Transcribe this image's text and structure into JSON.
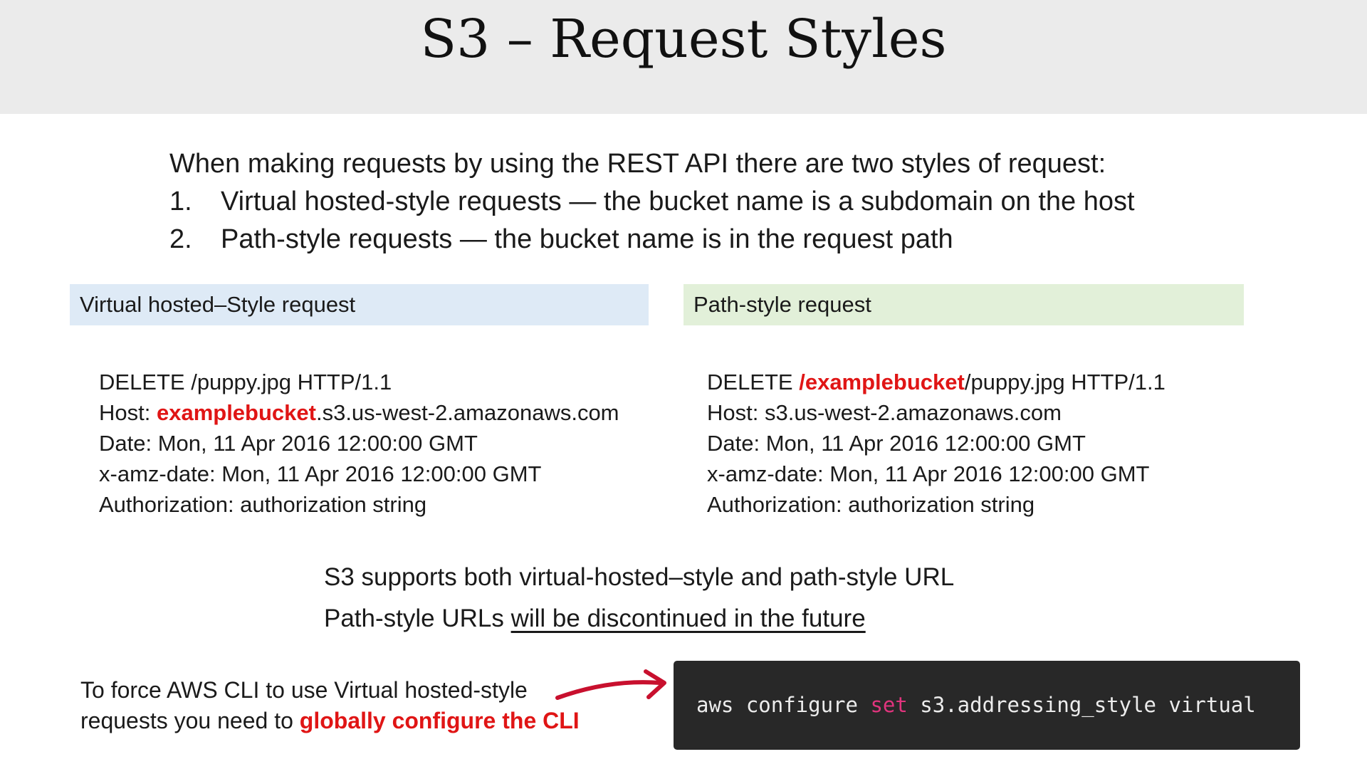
{
  "title": "S3 – Request Styles",
  "intro": {
    "lead": "When making requests by using the REST API there are two styles of request:",
    "items": [
      {
        "num": "1.",
        "text": "Virtual hosted-style requests — the bucket name is a subdomain on the host"
      },
      {
        "num": "2.",
        "text": "Path-style requests — the bucket name is in the request path"
      }
    ]
  },
  "virtual": {
    "header": "Virtual hosted–Style request",
    "line1": "DELETE /puppy.jpg HTTP/1.1",
    "host_label": "Host: ",
    "host_bucket": "examplebucket",
    "host_rest": ".s3.us-west-2.amazonaws.com",
    "date": "Date: Mon, 11 Apr 2016 12:00:00 GMT",
    "amz_date": "x-amz-date: Mon, 11 Apr 2016 12:00:00 GMT",
    "auth": "Authorization: authorization string"
  },
  "path": {
    "header": "Path-style request",
    "line1_prefix": "DELETE ",
    "line1_bucket": "/examplebucket",
    "line1_rest": "/puppy.jpg HTTP/1.1",
    "host": "Host: s3.us-west-2.amazonaws.com",
    "date": "Date: Mon, 11 Apr 2016 12:00:00 GMT",
    "amz_date": "x-amz-date: Mon, 11 Apr 2016 12:00:00 GMT",
    "auth": "Authorization: authorization string"
  },
  "support": {
    "line1": "S3 supports both virtual-hosted–style and path-style URL",
    "line2_prefix": "Path-style URLs ",
    "line2_underlined": "will be discontinued in the future"
  },
  "force": {
    "line1": "To force AWS CLI to use Virtual hosted-style",
    "line2_prefix": "requests you need to ",
    "line2_emphasis": "globally configure the CLI"
  },
  "command": {
    "part1": "aws configure ",
    "keyword": "set",
    "part2": " s3.addressing_style virtual"
  },
  "colors": {
    "accent_red": "#e01515",
    "virtual_header_bg": "#deeaf6",
    "path_header_bg": "#e2f0d9",
    "code_bg": "#282828",
    "code_keyword": "#e0347d"
  }
}
